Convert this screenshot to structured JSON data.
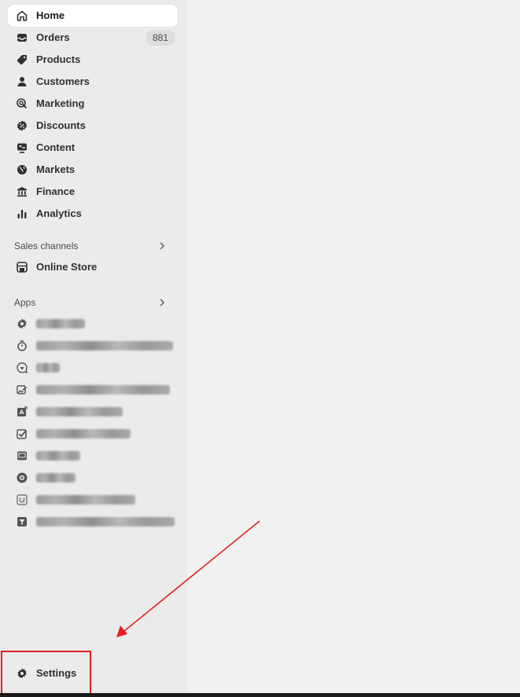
{
  "nav": {
    "home": "Home",
    "orders": "Orders",
    "orders_count": "881",
    "products": "Products",
    "customers": "Customers",
    "marketing": "Marketing",
    "discounts": "Discounts",
    "content": "Content",
    "markets": "Markets",
    "finance": "Finance",
    "analytics": "Analytics"
  },
  "sales_channels": {
    "title": "Sales channels",
    "online_store": "Online Store"
  },
  "apps": {
    "title": "Apps"
  },
  "settings": {
    "label": "Settings"
  },
  "colors": {
    "sidebar_bg": "#ebebeb",
    "content_bg": "#f1f1f1",
    "annotation": "#e0201d"
  },
  "icons": [
    "home-icon",
    "orders-icon",
    "products-icon",
    "customers-icon",
    "marketing-icon",
    "discounts-icon",
    "content-icon",
    "markets-icon",
    "finance-icon",
    "analytics-icon",
    "online-store-icon",
    "gear-icon"
  ]
}
